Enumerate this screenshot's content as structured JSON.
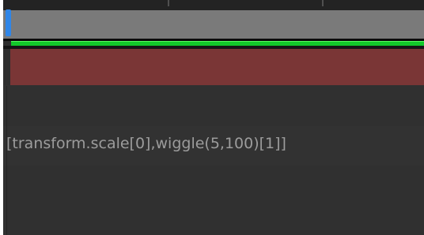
{
  "timeline": {
    "expression_text": "[transform.scale[0],wiggle(5,100)[1]]"
  },
  "colors": {
    "panel_background": "#2e2e2e",
    "layer_bar": "#7a7a7a",
    "time_indicator": "#2f86e8",
    "motion_path": "#12c82a",
    "keyframe_bar": "#7a3636",
    "expression_text": "#9c9c9c"
  }
}
